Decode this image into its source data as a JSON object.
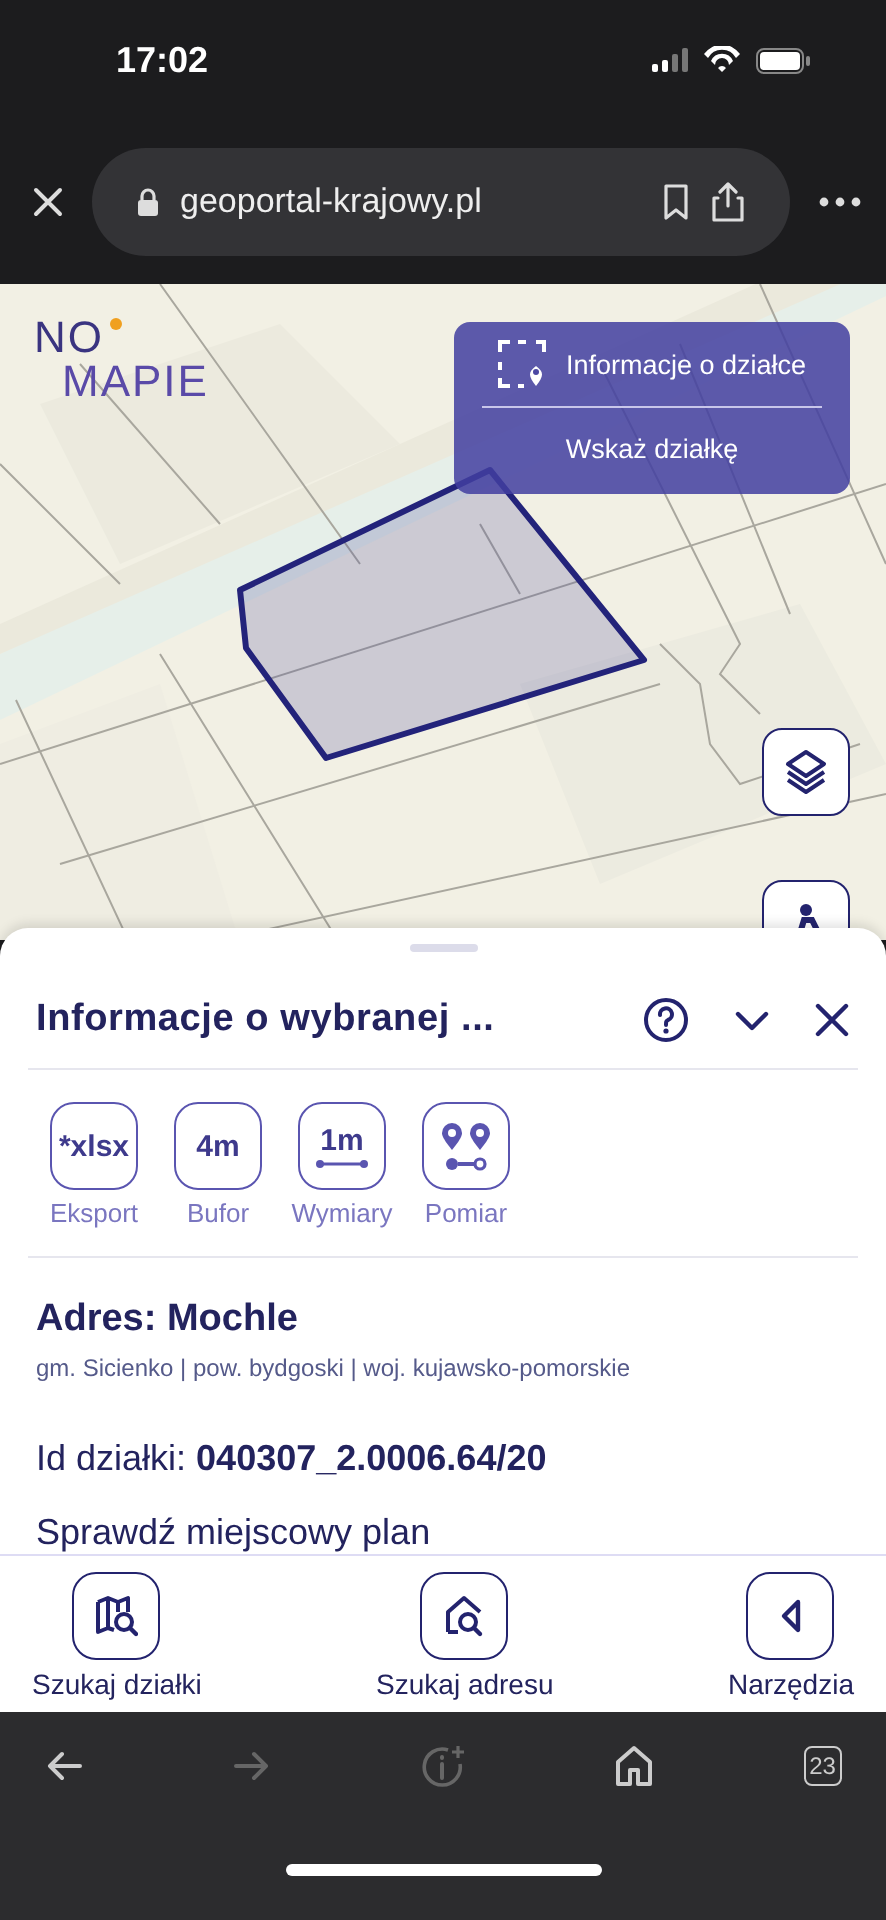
{
  "status_bar": {
    "time": "17:02"
  },
  "browser": {
    "url": "geoportal-krajowy.pl",
    "tab_count": "23"
  },
  "map": {
    "logo": {
      "line_1": "NO",
      "line_2": "MAPIE"
    },
    "parcel_panel": {
      "title": "Informacje o działce",
      "action": "Wskaż działkę"
    }
  },
  "sheet": {
    "title": "Informacje o wybranej ...",
    "tools": [
      {
        "kind": "text",
        "glyph": "*xlsx",
        "label": "Eksport"
      },
      {
        "kind": "text",
        "glyph": "4m",
        "label": "Bufor"
      },
      {
        "kind": "measure",
        "glyph": "1m",
        "label": "Wymiary"
      },
      {
        "kind": "pins",
        "label": "Pomiar"
      }
    ],
    "address": "Adres: Mochle",
    "address_details": "gm. Sicienko | pow. bydgoski | woj. kujawsko-pomorskie",
    "parcel_id": "Id działki: **040307_2.0006.64/20**",
    "plan_link": "Sprawdź miejscowy plan"
  },
  "bottom_nav": [
    {
      "kind": "parcel-search",
      "label": "Szukaj działki"
    },
    {
      "kind": "address-search",
      "label": "Szukaj adresu"
    },
    {
      "kind": "tools",
      "label": "Narzędzia"
    }
  ]
}
